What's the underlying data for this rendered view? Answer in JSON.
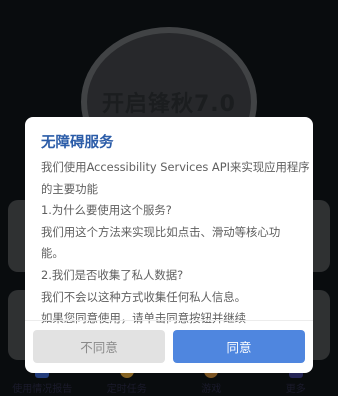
{
  "background": {
    "hero_title": "开启锋秋7.0",
    "nav": [
      {
        "label": "使用情况报告",
        "icon": "report-icon",
        "color": "#3a63c9"
      },
      {
        "label": "定时任务",
        "icon": "clock-icon",
        "color": "#d9a23a"
      },
      {
        "label": "游戏",
        "icon": "game-icon",
        "color": "#c98a3a"
      },
      {
        "label": "更多",
        "icon": "more-icon",
        "color": "#3a3a8a"
      }
    ]
  },
  "dialog": {
    "title": "无障碍服务",
    "lines": [
      "我们使用Accessibility Services API来实现应用程序",
      "的主要功能",
      "1.为什么要使用这个服务?",
      "我们用这个方法来实现比如点击、滑动等核心功",
      "能。",
      "2.我们是否收集了私人数据?",
      "我们不会以这种方式收集任何私人信息。",
      "如果您同意使用，请单击同意按钮并继续"
    ],
    "cancel_label": "不同意",
    "ok_label": "同意"
  },
  "colors": {
    "title": "#2b5ca8",
    "primary": "#4f86df",
    "cancel_bg": "#e2e2e2"
  }
}
